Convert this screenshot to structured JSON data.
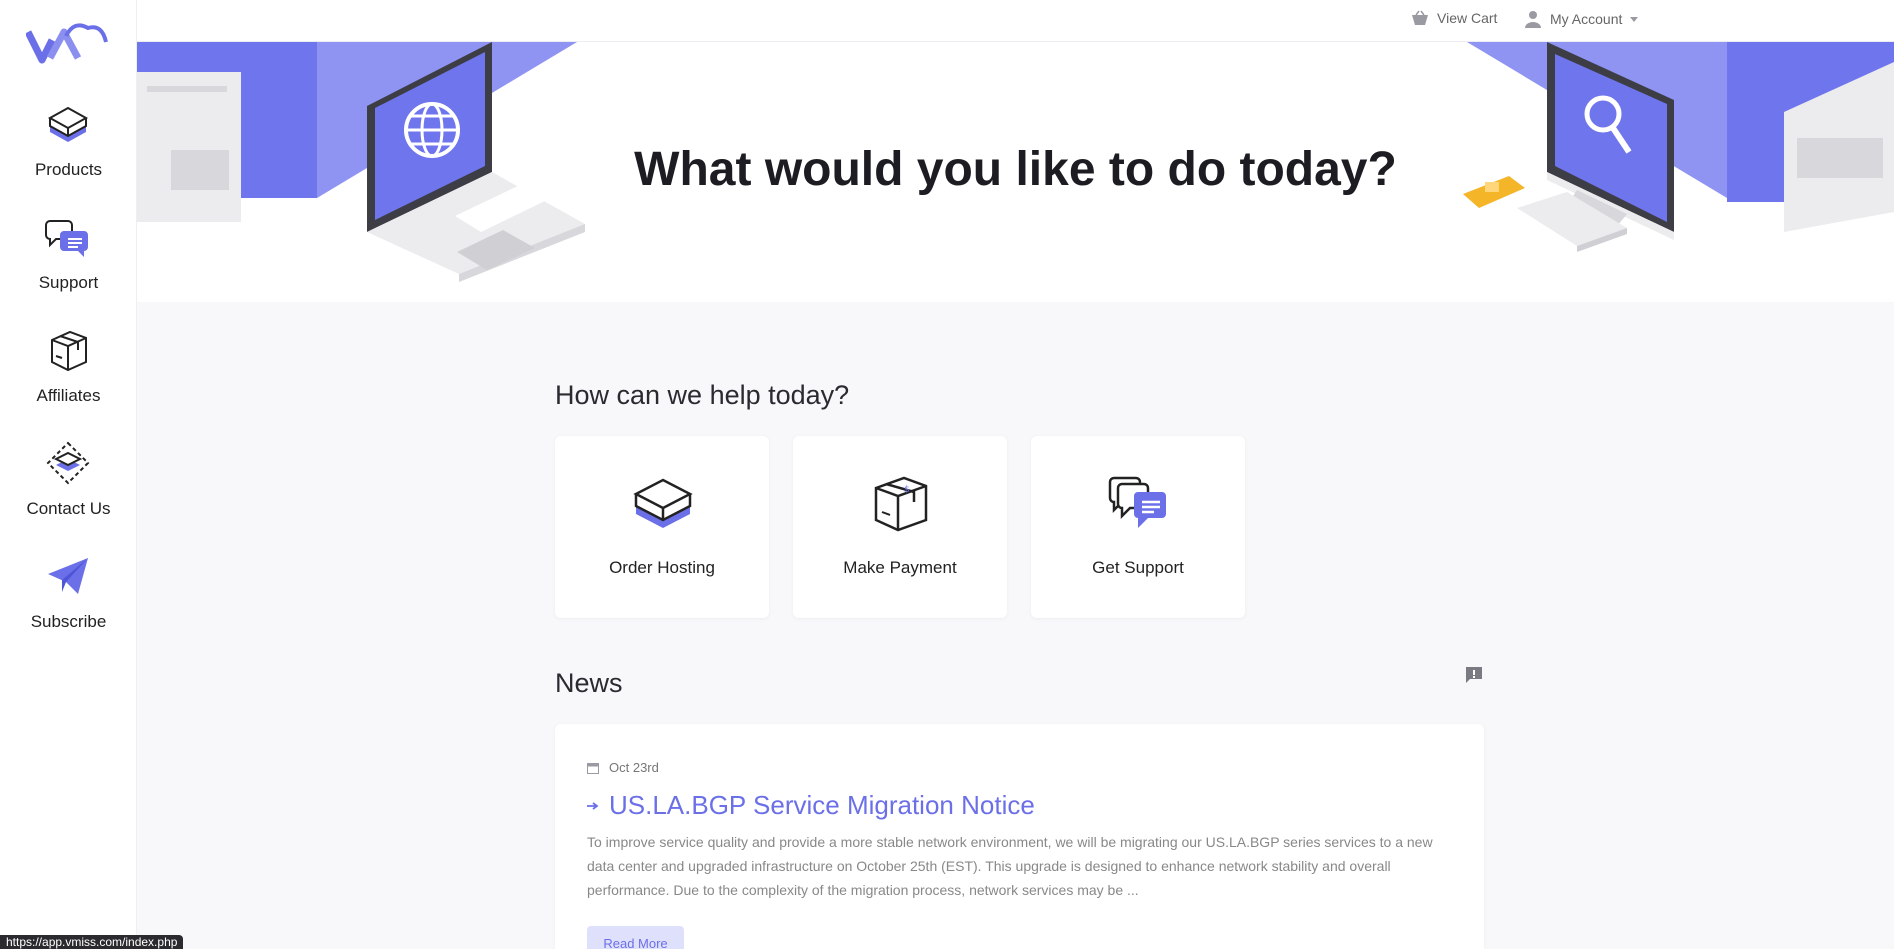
{
  "sidebar": {
    "items": [
      {
        "label": "Products",
        "icon": "products-icon"
      },
      {
        "label": "Support",
        "icon": "support-icon"
      },
      {
        "label": "Affiliates",
        "icon": "affiliates-icon"
      },
      {
        "label": "Contact Us",
        "icon": "contact-icon"
      },
      {
        "label": "Subscribe",
        "icon": "paper-plane-icon"
      }
    ]
  },
  "topbar": {
    "cart_label": "View Cart",
    "account_label": "My Account"
  },
  "hero": {
    "title": "What would you like to do today?"
  },
  "help": {
    "title": "How can we help today?",
    "cards": [
      {
        "label": "Order Hosting",
        "icon": "server-box-icon"
      },
      {
        "label": "Make Payment",
        "icon": "package-icon"
      },
      {
        "label": "Get Support",
        "icon": "chat-bubbles-icon"
      }
    ]
  },
  "news": {
    "title": "News",
    "items": [
      {
        "date": "Oct 23rd",
        "title": "US.LA.BGP Service Migration Notice",
        "excerpt": "To improve service quality and provide a more stable network environment, we will be migrating our US.LA.BGP series services to a new data center and upgraded infrastructure on October 25th (EST). This upgrade is designed to enhance network stability and overall performance. Due to the complexity of the migration process, network services may be ...",
        "read_more": "Read More"
      }
    ]
  },
  "status_bar": {
    "url": "https://app.vmiss.com/index.php"
  },
  "colors": {
    "accent": "#6b70e8",
    "accent_light": "#dfe0fb",
    "hero_purple": "#7379ee"
  }
}
